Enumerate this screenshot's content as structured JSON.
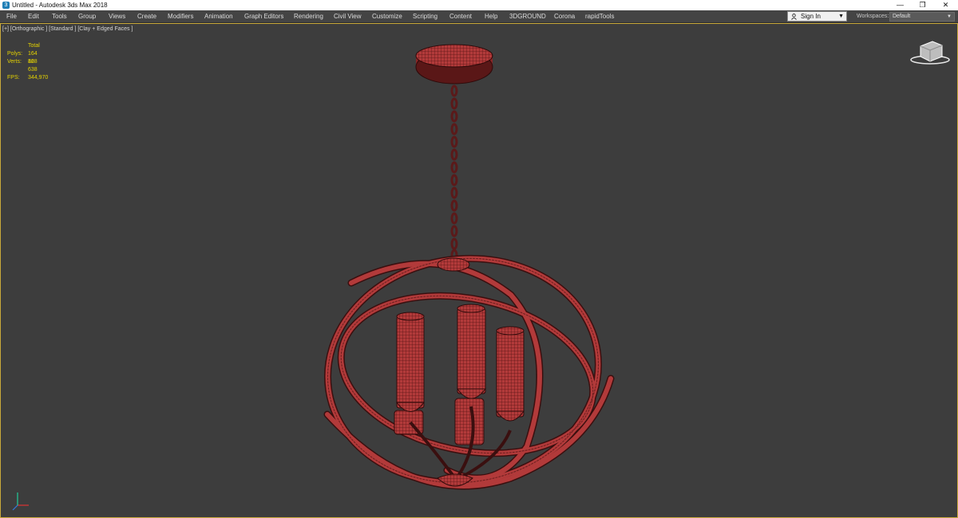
{
  "window": {
    "title": "Untitled - Autodesk 3ds Max 2018",
    "controls": {
      "minimize": "—",
      "restore": "❐",
      "close": "✕"
    }
  },
  "menu": [
    "File",
    "Edit",
    "Tools",
    "Group",
    "Views",
    "Create",
    "Modifiers",
    "Animation",
    "Graph Editors",
    "Rendering",
    "Civil View",
    "Customize",
    "Scripting",
    "Content",
    "Help",
    "3DGROUND",
    "Corona",
    "rapidTools"
  ],
  "account": {
    "sign_in_label": "Sign In",
    "icon": "user-icon"
  },
  "workspaces": {
    "label": "Workspaces:",
    "value": "Default"
  },
  "viewport": {
    "label": "[+] [Orthographic ] [Standard ] [Clay + Edged Faces ]",
    "stats": {
      "total_label": "Total",
      "polys_label": "Polys:",
      "polys_value": "164 168",
      "verts_label": "Verts:",
      "verts_value": "82 638",
      "fps_label": "FPS:",
      "fps_value": "344,970"
    },
    "model": "chandelier wireframe"
  },
  "colors": {
    "model": "#b23a3a",
    "wire": "#3a0f0f",
    "stats": "#e4d200",
    "viewport_border": "#c9a93a"
  }
}
